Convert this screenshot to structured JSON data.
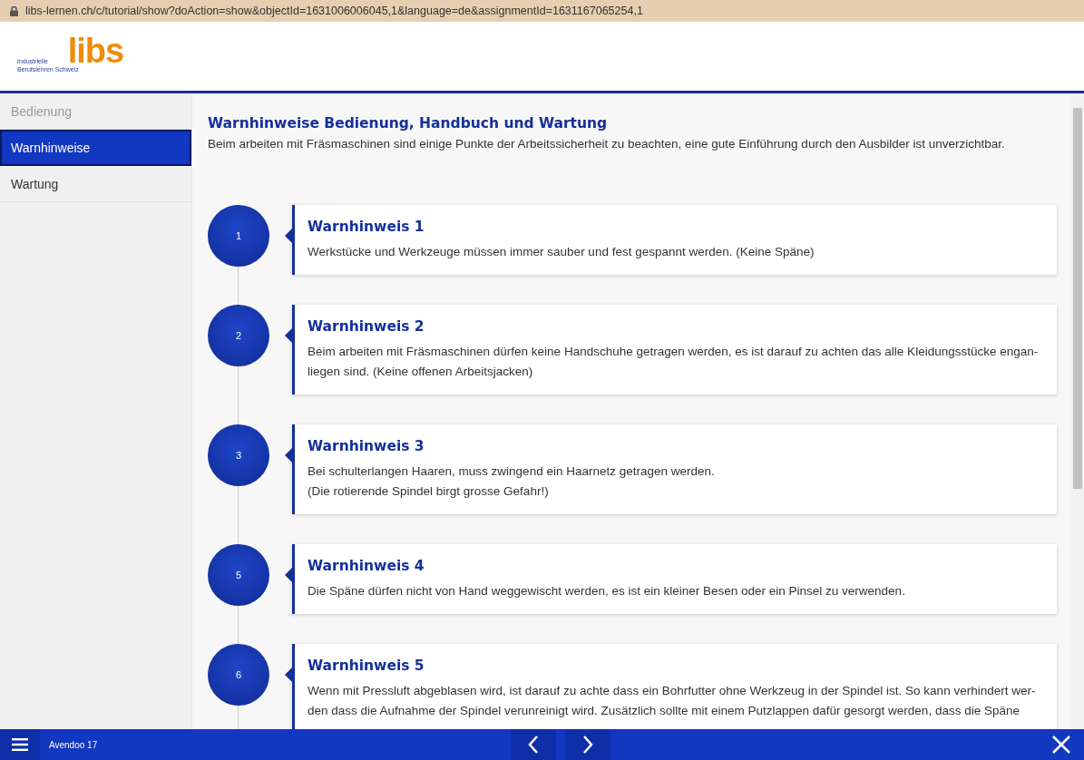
{
  "address_bar": {
    "url": "libs-lernen.ch/c/tutorial/show?doAction=show&objectId=1631006006045,1&language=de&assignmentId=1631167065254,1"
  },
  "logo": {
    "wordmark": "libs",
    "line_1": "Industrielle",
    "line_2": "Berufslehren Schweiz"
  },
  "sidebar": {
    "items": [
      {
        "label": "Bedienung",
        "selected": false,
        "disabled": true
      },
      {
        "label": "Warnhinweise",
        "selected": true,
        "disabled": false
      },
      {
        "label": "Wartung",
        "selected": false,
        "disabled": false
      }
    ]
  },
  "content": {
    "title": "Warnhinweise Bedienung, Handbuch und Wartung",
    "intro": "Beim arbeiten mit Fräsmaschinen sind einige Punkte der Arbeitssicherheit zu beachten, eine gute Einführung durch den Ausbilder ist unverzichtbar.",
    "steps": [
      {
        "number": "1",
        "title": "Warnhinweis 1",
        "body": "Werkstücke und Werkzeuge müssen immer sauber und fest gespannt werden. (Keine Späne)"
      },
      {
        "number": "2",
        "title": "Warnhinweis 2",
        "body": "Beim arbeiten mit Fräsmaschinen dürfen keine Handschuhe getragen werden, es ist darauf zu achten das alle Kleidungsstücke engan-\nliegen sind. (Keine offenen Arbeitsjacken)"
      },
      {
        "number": "3",
        "title": "Warnhinweis 3",
        "body": "Bei schulterlangen Haaren, muss zwingend ein Haarnetz getragen werden.\n(Die rotierende Spindel birgt grosse Gefahr!)"
      },
      {
        "number": "5",
        "title": "Warnhinweis 4",
        "body": "Die Späne dürfen nicht von Hand weggewischt werden, es ist ein kleiner Besen oder ein Pinsel zu verwenden."
      },
      {
        "number": "6",
        "title": "Warnhinweis 5",
        "body": "Wenn mit Pressluft abgeblasen wird, ist darauf zu achte dass ein Bohrfutter ohne Werkzeug in der Spindel ist. So kann verhindert wer-\nden dass die Aufnahme der Spindel  verunreinigt wird. Zusätzlich sollte mit einem Putzlappen dafür gesorgt werden, dass die Späne"
      }
    ]
  },
  "bottom_bar": {
    "app_name": "Avendoo 17"
  }
}
